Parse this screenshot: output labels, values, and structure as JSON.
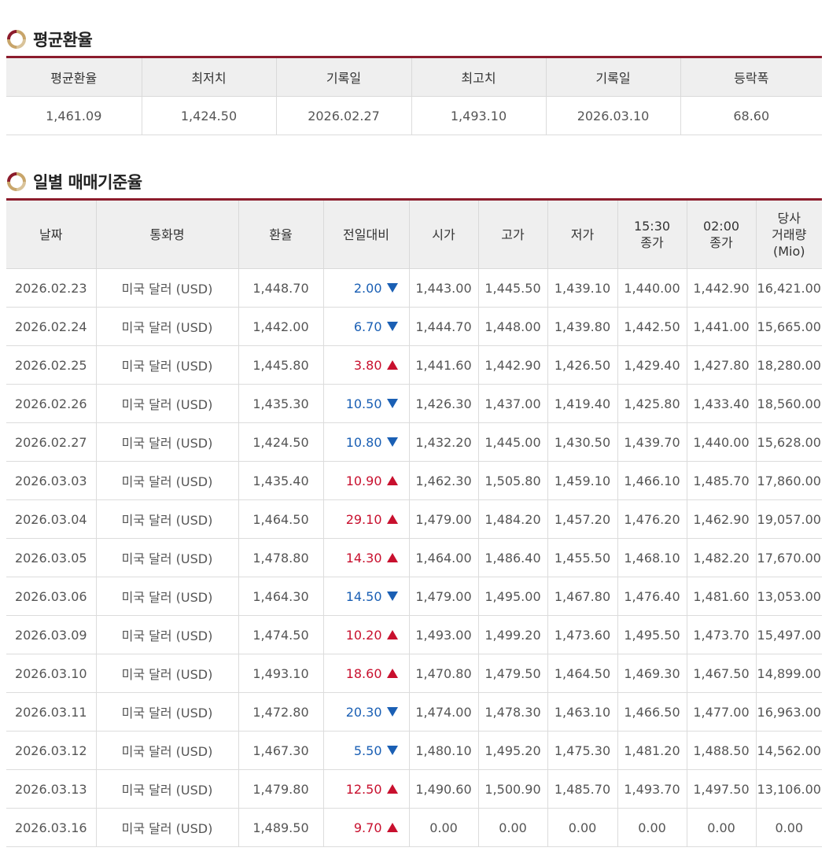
{
  "average": {
    "title": "평균환율",
    "headers": [
      "평균환율",
      "최저치",
      "기록일",
      "최고치",
      "기록일",
      "등락폭"
    ],
    "values": [
      "1,461.09",
      "1,424.50",
      "2026.02.27",
      "1,493.10",
      "2026.03.10",
      "68.60"
    ]
  },
  "daily": {
    "title": "일별 매매기준율",
    "headers": [
      "날짜",
      "통화명",
      "환율",
      "전일대비",
      "시가",
      "고가",
      "저가",
      "15:30\n종가",
      "02:00\n종가",
      "당사\n거래량\n(Mio)"
    ],
    "rows": [
      {
        "date": "2026.02.23",
        "currency": "미국 달러 (USD)",
        "rate": "1,448.70",
        "change": "2.00",
        "dir": "down",
        "open": "1,443.00",
        "high": "1,445.50",
        "low": "1,439.10",
        "close1530": "1,440.00",
        "close0200": "1,442.90",
        "volume": "16,421.00"
      },
      {
        "date": "2026.02.24",
        "currency": "미국 달러 (USD)",
        "rate": "1,442.00",
        "change": "6.70",
        "dir": "down",
        "open": "1,444.70",
        "high": "1,448.00",
        "low": "1,439.80",
        "close1530": "1,442.50",
        "close0200": "1,441.00",
        "volume": "15,665.00"
      },
      {
        "date": "2026.02.25",
        "currency": "미국 달러 (USD)",
        "rate": "1,445.80",
        "change": "3.80",
        "dir": "up",
        "open": "1,441.60",
        "high": "1,442.90",
        "low": "1,426.50",
        "close1530": "1,429.40",
        "close0200": "1,427.80",
        "volume": "18,280.00"
      },
      {
        "date": "2026.02.26",
        "currency": "미국 달러 (USD)",
        "rate": "1,435.30",
        "change": "10.50",
        "dir": "down",
        "open": "1,426.30",
        "high": "1,437.00",
        "low": "1,419.40",
        "close1530": "1,425.80",
        "close0200": "1,433.40",
        "volume": "18,560.00"
      },
      {
        "date": "2026.02.27",
        "currency": "미국 달러 (USD)",
        "rate": "1,424.50",
        "change": "10.80",
        "dir": "down",
        "open": "1,432.20",
        "high": "1,445.00",
        "low": "1,430.50",
        "close1530": "1,439.70",
        "close0200": "1,440.00",
        "volume": "15,628.00"
      },
      {
        "date": "2026.03.03",
        "currency": "미국 달러 (USD)",
        "rate": "1,435.40",
        "change": "10.90",
        "dir": "up",
        "open": "1,462.30",
        "high": "1,505.80",
        "low": "1,459.10",
        "close1530": "1,466.10",
        "close0200": "1,485.70",
        "volume": "17,860.00"
      },
      {
        "date": "2026.03.04",
        "currency": "미국 달러 (USD)",
        "rate": "1,464.50",
        "change": "29.10",
        "dir": "up",
        "open": "1,479.00",
        "high": "1,484.20",
        "low": "1,457.20",
        "close1530": "1,476.20",
        "close0200": "1,462.90",
        "volume": "19,057.00"
      },
      {
        "date": "2026.03.05",
        "currency": "미국 달러 (USD)",
        "rate": "1,478.80",
        "change": "14.30",
        "dir": "up",
        "open": "1,464.00",
        "high": "1,486.40",
        "low": "1,455.50",
        "close1530": "1,468.10",
        "close0200": "1,482.20",
        "volume": "17,670.00"
      },
      {
        "date": "2026.03.06",
        "currency": "미국 달러 (USD)",
        "rate": "1,464.30",
        "change": "14.50",
        "dir": "down",
        "open": "1,479.00",
        "high": "1,495.00",
        "low": "1,467.80",
        "close1530": "1,476.40",
        "close0200": "1,481.60",
        "volume": "13,053.00"
      },
      {
        "date": "2026.03.09",
        "currency": "미국 달러 (USD)",
        "rate": "1,474.50",
        "change": "10.20",
        "dir": "up",
        "open": "1,493.00",
        "high": "1,499.20",
        "low": "1,473.60",
        "close1530": "1,495.50",
        "close0200": "1,473.70",
        "volume": "15,497.00"
      },
      {
        "date": "2026.03.10",
        "currency": "미국 달러 (USD)",
        "rate": "1,493.10",
        "change": "18.60",
        "dir": "up",
        "open": "1,470.80",
        "high": "1,479.50",
        "low": "1,464.50",
        "close1530": "1,469.30",
        "close0200": "1,467.50",
        "volume": "14,899.00"
      },
      {
        "date": "2026.03.11",
        "currency": "미국 달러 (USD)",
        "rate": "1,472.80",
        "change": "20.30",
        "dir": "down",
        "open": "1,474.00",
        "high": "1,478.30",
        "low": "1,463.10",
        "close1530": "1,466.50",
        "close0200": "1,477.00",
        "volume": "16,963.00"
      },
      {
        "date": "2026.03.12",
        "currency": "미국 달러 (USD)",
        "rate": "1,467.30",
        "change": "5.50",
        "dir": "down",
        "open": "1,480.10",
        "high": "1,495.20",
        "low": "1,475.30",
        "close1530": "1,481.20",
        "close0200": "1,488.50",
        "volume": "14,562.00"
      },
      {
        "date": "2026.03.13",
        "currency": "미국 달러 (USD)",
        "rate": "1,479.80",
        "change": "12.50",
        "dir": "up",
        "open": "1,490.60",
        "high": "1,500.90",
        "low": "1,485.70",
        "close1530": "1,493.70",
        "close0200": "1,497.50",
        "volume": "13,106.00"
      },
      {
        "date": "2026.03.16",
        "currency": "미국 달러 (USD)",
        "rate": "1,489.50",
        "change": "9.70",
        "dir": "up",
        "open": "0.00",
        "high": "0.00",
        "low": "0.00",
        "close1530": "0.00",
        "close0200": "0.00",
        "volume": "0.00"
      }
    ]
  },
  "colors": {
    "accent": "#8c1c2c",
    "up": "#c8102e",
    "down": "#1a5fb4",
    "header_bg": "#efefef",
    "icon_gold": "#c8a56a"
  },
  "icons": {
    "section": "ring-bullet-icon",
    "up": "triangle-up-icon",
    "down": "triangle-down-icon"
  }
}
